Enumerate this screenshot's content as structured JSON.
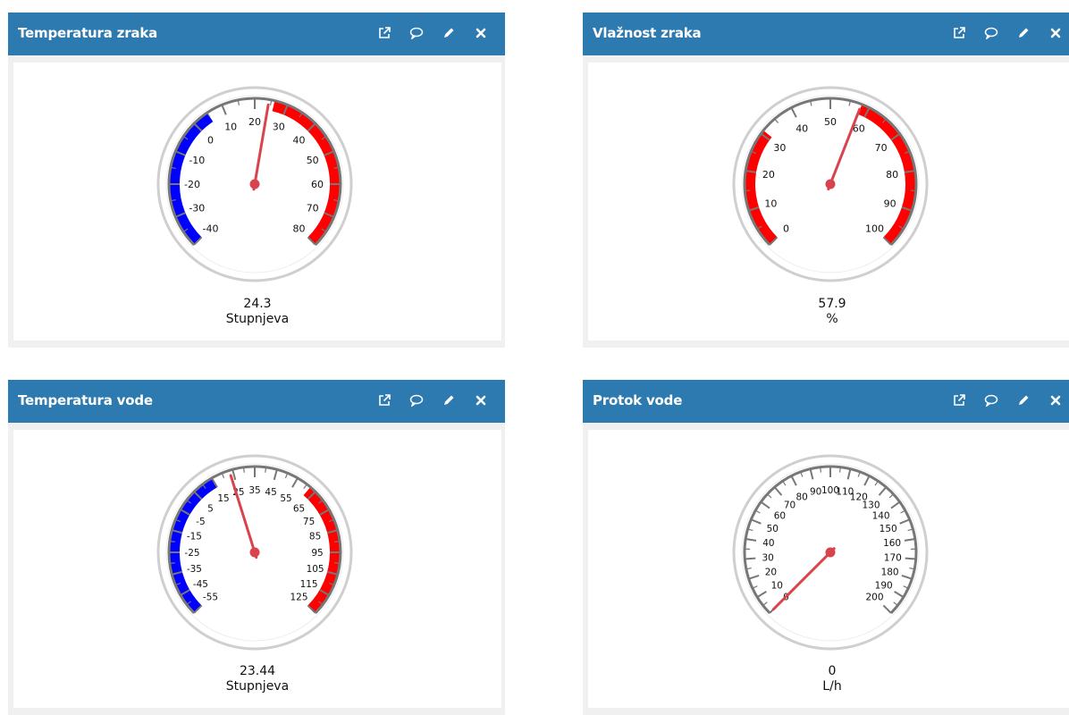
{
  "colors": {
    "header": "#2d7ab0",
    "low_band": "#0000ff",
    "high_band": "#ff0000",
    "needle": "#d9434e",
    "scale": "#777777"
  },
  "header_icons": [
    "external-link-icon",
    "comment-icon",
    "pencil-icon",
    "close-icon"
  ],
  "widgets": [
    {
      "title": "Temperatura zraka",
      "value": "24.3",
      "unit": "Stupnjeva",
      "gauge": {
        "min": -40,
        "max": 80,
        "labels": [
          "-40",
          "-30",
          "-20",
          "-10",
          "0",
          "10",
          "20",
          "30",
          "40",
          "50",
          "60",
          "70",
          "80"
        ],
        "bands": [
          {
            "from": -40,
            "to": 5,
            "color": "#0000ff"
          },
          {
            "from": 26,
            "to": 80,
            "color": "#ff0000"
          }
        ],
        "needle_value": 24.3
      }
    },
    {
      "title": "Vlažnost zraka",
      "value": "57.9",
      "unit": "%",
      "gauge": {
        "min": 0,
        "max": 100,
        "labels": [
          "0",
          "10",
          "20",
          "30",
          "40",
          "50",
          "60",
          "70",
          "80",
          "90",
          "100"
        ],
        "bands": [
          {
            "from": 0,
            "to": 31,
            "color": "#ff0000"
          },
          {
            "from": 58,
            "to": 100,
            "color": "#ff0000"
          }
        ],
        "needle_value": 57.9
      }
    },
    {
      "title": "Temperatura vode",
      "value": "23.44",
      "unit": "Stupnjeva",
      "gauge": {
        "min": -55,
        "max": 125,
        "labels": [
          "-55",
          "-45",
          "-35",
          "-25",
          "-15",
          "-5",
          "5",
          "15",
          "25",
          "35",
          "45",
          "55",
          "65",
          "75",
          "85",
          "95",
          "105",
          "115",
          "125"
        ],
        "bands": [
          {
            "from": -55,
            "to": 15,
            "color": "#0000ff"
          },
          {
            "from": 62,
            "to": 125,
            "color": "#ff0000"
          }
        ],
        "needle_value": 23.44
      }
    },
    {
      "title": "Protok vode",
      "value": "0",
      "unit": "L/h",
      "gauge": {
        "min": 0,
        "max": 200,
        "labels": [
          "0",
          "10",
          "20",
          "30",
          "40",
          "50",
          "60",
          "70",
          "80",
          "90",
          "100",
          "110",
          "120",
          "130",
          "140",
          "150",
          "160",
          "170",
          "180",
          "190",
          "200"
        ],
        "bands": [],
        "needle_value": 0
      }
    }
  ]
}
